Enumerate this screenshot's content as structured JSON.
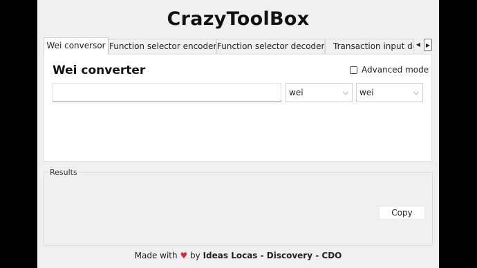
{
  "app": {
    "title": "CrazyToolBox"
  },
  "tabs": [
    {
      "label": "Wei conversor",
      "active": true
    },
    {
      "label": "Function selector encoder",
      "active": false
    },
    {
      "label": "Function selector decoder",
      "active": false
    },
    {
      "label": "Transaction input deco",
      "active": false
    }
  ],
  "tab_scroll": {
    "left_icon": "◀",
    "right_icon": "▶"
  },
  "converter": {
    "title": "Wei converter",
    "advanced_mode_label": "Advanced mode",
    "advanced_mode_checked": false,
    "amount_value": "",
    "from_unit": "wei",
    "to_unit": "wei",
    "chevron": "⌵"
  },
  "results": {
    "label": "Results",
    "copy_label": "Copy"
  },
  "footer": {
    "made_with": "Made with",
    "heart": "♥",
    "by": "by",
    "brand": "Ideas Locas - Discovery - CDO"
  },
  "colors": {
    "heart": "#e0243a",
    "window_bg": "#f0f0f0",
    "panel_bg": "#ffffff"
  }
}
